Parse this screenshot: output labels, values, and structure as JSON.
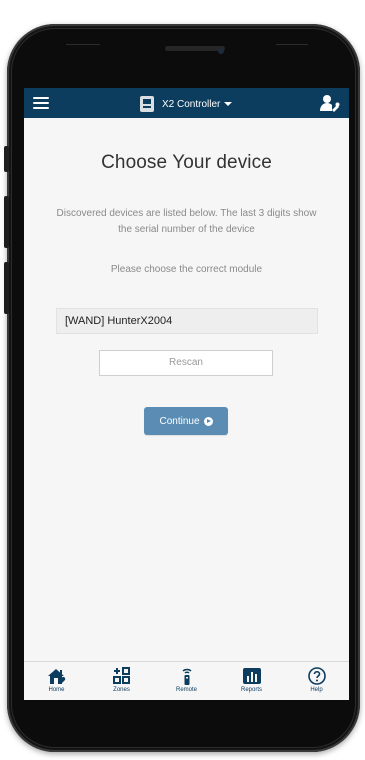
{
  "topbar": {
    "title": "X2 Controller",
    "menu_icon": "hamburger-icon",
    "controller_icon": "controller-icon",
    "caret_icon": "caret-down-icon",
    "user_icon": "user-settings-icon"
  },
  "main": {
    "heading": "Choose Your device",
    "description": "Discovered devices are listed below. The last 3 digits show the serial number of the device",
    "instruction": "Please choose the correct module",
    "devices": [
      "[WAND] HunterX2004"
    ],
    "rescan_label": "Rescan",
    "continue_label": "Continue"
  },
  "nav": {
    "items": [
      {
        "label": "Home",
        "icon": "home-icon"
      },
      {
        "label": "Zones",
        "icon": "zones-icon"
      },
      {
        "label": "Remote",
        "icon": "remote-icon"
      },
      {
        "label": "Reports",
        "icon": "reports-icon"
      },
      {
        "label": "Help",
        "icon": "help-icon"
      }
    ]
  },
  "colors": {
    "brand": "#0c3c5e",
    "button": "#5b8db4",
    "background": "#f6f6f6"
  }
}
